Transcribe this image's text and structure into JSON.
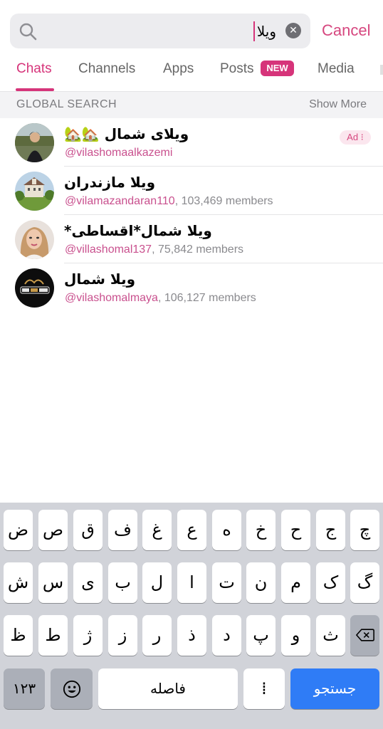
{
  "search": {
    "query": "ویلا",
    "cancel_label": "Cancel"
  },
  "tabs": [
    {
      "label": "Chats",
      "active": true
    },
    {
      "label": "Channels",
      "active": false
    },
    {
      "label": "Apps",
      "active": false
    },
    {
      "label": "Posts",
      "active": false
    },
    {
      "label": "Media",
      "active": false
    }
  ],
  "posts_badge": "NEW",
  "section": {
    "title": "GLOBAL SEARCH",
    "show_more": "Show More"
  },
  "results": [
    {
      "name": "ویلای شمال 🏡🏡",
      "handle": "@vilashomaalkazemi",
      "members": "",
      "ad": "Ad ⁝"
    },
    {
      "name": "ویلا مازندران",
      "handle": "@vilamazandaran110",
      "members": ", 103,469 members"
    },
    {
      "name": "ویلا شمال*اقساطی*",
      "handle": "@villashomal137",
      "members": ", 75,842 members"
    },
    {
      "name": "ویلا شمال",
      "handle": "@vilashomalmaya",
      "members": ", 106,127 members"
    }
  ],
  "keyboard": {
    "row1": [
      "ض",
      "ص",
      "ق",
      "ف",
      "غ",
      "ع",
      "ه",
      "خ",
      "ح",
      "ج",
      "چ"
    ],
    "row2": [
      "ش",
      "س",
      "ی",
      "ب",
      "ل",
      "ا",
      "ت",
      "ن",
      "م",
      "ک",
      "گ"
    ],
    "row3": [
      "ظ",
      "ط",
      "ژ",
      "ز",
      "ر",
      "ذ",
      "د",
      "پ",
      "و",
      "ث"
    ],
    "numbers_label": "۱۲۳",
    "space_label": "فاصله",
    "search_label": "جستجو",
    "zwnj_label": "⁞"
  },
  "colors": {
    "accent": "#d6347a",
    "keyboard_bg": "#d1d3d9",
    "go_key": "#2f7cf6"
  }
}
